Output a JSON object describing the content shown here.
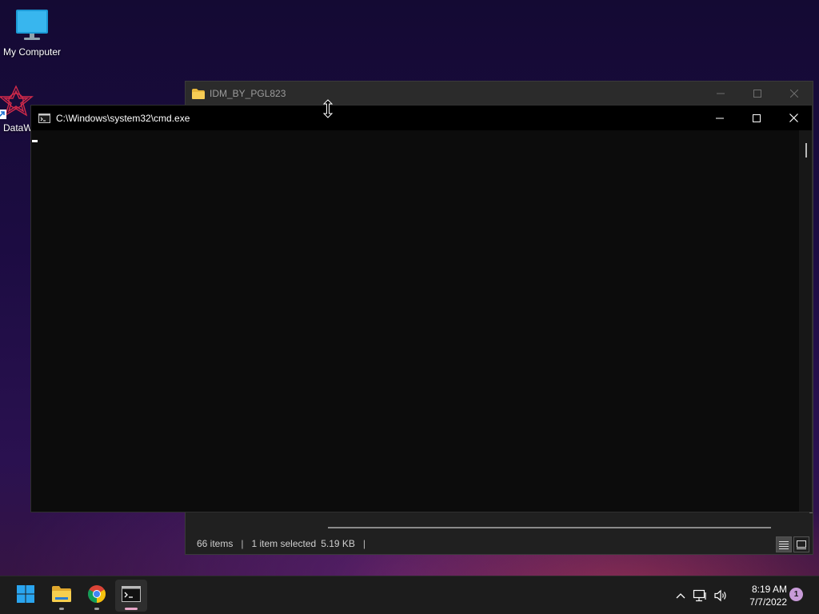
{
  "desktop": {
    "icons": [
      {
        "label": "My Computer",
        "icon": "monitor-icon"
      },
      {
        "label": "DataW",
        "icon": "datawrapper-icon"
      }
    ]
  },
  "explorer": {
    "title": "IDM_BY_PGL823",
    "status": {
      "items": "66 items",
      "selected": "1 item selected",
      "size": "5.19 KB"
    }
  },
  "cmd": {
    "title": "C:\\Windows\\system32\\cmd.exe"
  },
  "taskbar": {
    "apps": [
      {
        "name": "Start",
        "icon": "windows-start-icon"
      },
      {
        "name": "File Explorer",
        "icon": "file-explorer-icon"
      },
      {
        "name": "Google Chrome",
        "icon": "chrome-icon"
      },
      {
        "name": "Command Prompt",
        "icon": "cmd-icon"
      }
    ],
    "time": "8:19 AM",
    "date": "7/7/2022",
    "notifications": "1"
  },
  "colors": {
    "cmd_bg": "#0c0c0c",
    "taskbar_bg": "#1c1c1c",
    "notif_badge": "#c89bd8",
    "active_indicator": "#e8a6c8"
  }
}
